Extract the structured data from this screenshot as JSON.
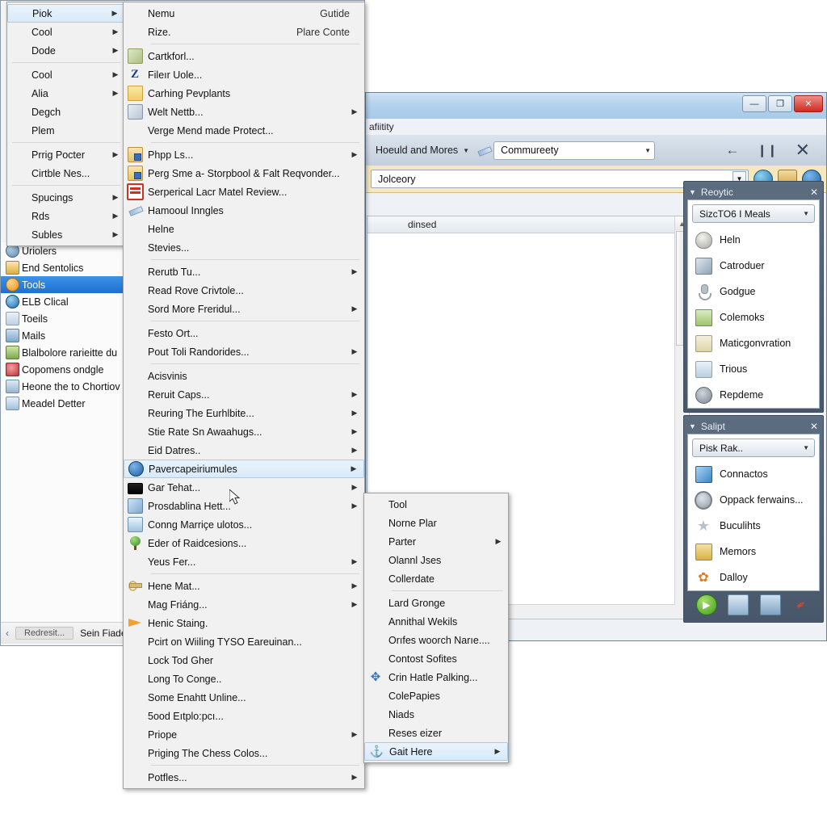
{
  "left_window": {
    "nav_items": [
      {
        "label": "Uriolers",
        "icon": "globe-icon",
        "selected": false
      },
      {
        "label": "End Sentolics",
        "icon": "document-icon",
        "selected": false
      },
      {
        "label": "Tools",
        "icon": "tools-icon",
        "selected": true
      },
      {
        "label": "ELB Clical",
        "icon": "disc-icon",
        "selected": false
      },
      {
        "label": "Toeils",
        "icon": "window-icon",
        "selected": false
      },
      {
        "label": "Mails",
        "icon": "mail-icon",
        "selected": false
      },
      {
        "label": "Blalbolore rarieitte du",
        "icon": "bag-icon",
        "selected": false
      },
      {
        "label": "Copomens ondgle",
        "icon": "heart-icon",
        "selected": false
      },
      {
        "label": "Heone the to Chortiov",
        "icon": "chart-icon",
        "selected": false
      },
      {
        "label": "Meadel Detter",
        "icon": "link-icon",
        "selected": false
      }
    ],
    "status": {
      "back": "‹",
      "pill": "Redresit...",
      "text": "Sein Fiade"
    }
  },
  "top_menu": {
    "items": [
      {
        "label": "Piok",
        "arrow": true,
        "highlight": true
      },
      {
        "label": "Cool",
        "arrow": true
      },
      {
        "label": "Dode",
        "arrow": true
      },
      {
        "sep": true
      },
      {
        "label": "Cool",
        "arrow": true
      },
      {
        "label": "Alia",
        "arrow": true
      },
      {
        "label": "Degch"
      },
      {
        "label": "Plem"
      },
      {
        "sep": true
      },
      {
        "label": "Prrig Pocter",
        "arrow": true
      },
      {
        "label": "Cirtble Nes..."
      },
      {
        "sep": true
      },
      {
        "label": "Spucings",
        "arrow": true
      },
      {
        "label": "Rds",
        "arrow": true
      },
      {
        "label": "Subles",
        "arrow": true
      }
    ]
  },
  "main_menu": {
    "items": [
      {
        "label": "Nemu",
        "accel": "Gutide"
      },
      {
        "label": "Rize.",
        "accel": "Plare Conte"
      },
      {
        "sep": true
      },
      {
        "label": "Cartkforl...",
        "icon": "printer-icon"
      },
      {
        "label": "Fileır Uole...",
        "icon": "z-icon"
      },
      {
        "label": "Carhing Pevplants",
        "icon": "folder-icon"
      },
      {
        "label": "Welt Nettb...",
        "icon": "grid-icon",
        "arrow": true
      },
      {
        "label": "Verge Mend made Protect..."
      },
      {
        "sep": true
      },
      {
        "label": "Phpp Ls...",
        "icon": "doc-blue-icon",
        "arrow": true
      },
      {
        "label": "Perg Sme a- Storpbool & Falt Reqvonder...",
        "icon": "doc-blue-icon"
      },
      {
        "label": "Serperical Lacr Matel Review...",
        "icon": "red-box-icon"
      },
      {
        "label": "Hamooul Inngles",
        "icon": "pen-icon"
      },
      {
        "label": "Helne"
      },
      {
        "label": "Stevies..."
      },
      {
        "sep": true
      },
      {
        "label": "Rerutb Tu...",
        "arrow": true
      },
      {
        "label": "Read Rove Crivtole..."
      },
      {
        "label": "Sord More Freridul...",
        "arrow": true
      },
      {
        "sep": true
      },
      {
        "label": "Festo Ort..."
      },
      {
        "label": "Pout Toli Randorides...",
        "arrow": true
      },
      {
        "sep": true
      },
      {
        "label": "Acisvinis"
      },
      {
        "label": "Reruit Caps...",
        "arrow": true
      },
      {
        "label": "Reuring The Eurhlbite...",
        "arrow": true
      },
      {
        "label": "Stie Rate Sn Awaahugs...",
        "arrow": true
      },
      {
        "label": "Eid Datres..",
        "arrow": true
      },
      {
        "label": "Pavercapeiriumules",
        "icon": "globe-icon",
        "arrow": true,
        "highlight": true
      },
      {
        "label": "Gar Tehat...",
        "icon": "screen-icon",
        "arrow": true
      },
      {
        "label": "Prosdablina Hett...",
        "icon": "blue-card-icon",
        "arrow": true
      },
      {
        "label": "Conng Marriçe ulotos...",
        "icon": "bottle-icon"
      },
      {
        "label": "Eder of Raidcesions...",
        "icon": "tree-icon"
      },
      {
        "label": "Yeus Fer...",
        "arrow": true
      },
      {
        "sep": true
      },
      {
        "label": "Hene Mat...",
        "icon": "key-icon",
        "arrow": true
      },
      {
        "label": "Mag Friáng...",
        "arrow": true
      },
      {
        "label": "Henic Staing.",
        "icon": "bird-icon"
      },
      {
        "label": "Pcirt on Wiiling TYSO Eareuinan..."
      },
      {
        "label": "Lock Tod Gher"
      },
      {
        "label": "Long To Conge.."
      },
      {
        "label": "Some Enahtt Unline..."
      },
      {
        "label": "5ood Eıtplo:pcı..."
      },
      {
        "label": "Priope",
        "arrow": true
      },
      {
        "label": "Priging The Chess Colos..."
      },
      {
        "sep": true
      },
      {
        "label": "Potfles...",
        "arrow": true
      }
    ]
  },
  "sub_menu": {
    "items": [
      {
        "label": "Tool"
      },
      {
        "label": "Norne Plar"
      },
      {
        "label": "Parter",
        "arrow": true
      },
      {
        "label": "Olannl Jses"
      },
      {
        "label": "Collerdate"
      },
      {
        "sep": true
      },
      {
        "label": "Lard Gronge"
      },
      {
        "label": "Annithal Wekils"
      },
      {
        "label": "Orıfes woorch Narıe...."
      },
      {
        "label": "Contost Sofites"
      },
      {
        "label": "Crin Hatle Palking...",
        "icon": "move-icon"
      },
      {
        "label": "ColePapies"
      },
      {
        "label": "Niads"
      },
      {
        "label": "Reses eizer"
      },
      {
        "label": "Gait Here",
        "icon": "anchor-icon",
        "arrow": true,
        "highlight": true
      }
    ]
  },
  "right_window": {
    "menu_label": "afiitity",
    "toolbar": {
      "dropdown_label": "Hoeuld and Mores",
      "combo_value": "Commureety",
      "actions": [
        "back-arrow-icon",
        "pause-icon",
        "close-x-icon"
      ]
    },
    "address_bar": {
      "value": "Jolceory",
      "icons": [
        "globe-icon",
        "picture-icon",
        "circle-blue-icon"
      ]
    },
    "content": {
      "column_header": "dinsed"
    },
    "panels": [
      {
        "title": "Reoytic",
        "combo": "SizcTO6 I Meals",
        "items": [
          {
            "label": "Heln",
            "icon": "bulb-icon"
          },
          {
            "label": "Catroduer",
            "icon": "book-icon"
          },
          {
            "label": "Godgue",
            "icon": "mic-icon"
          },
          {
            "label": "Colemoks",
            "icon": "folder-green-icon"
          },
          {
            "label": "Maticgonvration",
            "icon": "window-icon"
          },
          {
            "label": "Trious",
            "icon": "picture-icon"
          },
          {
            "label": "Repdeme",
            "icon": "gear-icon"
          }
        ]
      },
      {
        "title": "Salipt",
        "combo": "Pisk Rak..",
        "items": [
          {
            "label": "Connactos",
            "icon": "cube-icon"
          },
          {
            "label": "Oppack ferwains...",
            "icon": "ring-icon"
          },
          {
            "label": "Buculihts",
            "icon": "star-icon"
          },
          {
            "label": "Memors",
            "icon": "gold-icon"
          },
          {
            "label": "Dalloy",
            "icon": "fire-icon"
          }
        ],
        "footer_buttons": [
          "go-icon",
          "search-window-icon",
          "copy-icon",
          "eyedropper-icon"
        ]
      }
    ],
    "window_buttons": {
      "minimize": "—",
      "maximize": "❐",
      "close": "✕"
    }
  },
  "colors": {
    "selection_blue": "#1f6fd0",
    "menu_highlight": "#d9eafa",
    "dock_bg": "#48576a",
    "address_bar_bg": "#f6e7bd",
    "close_red": "#cf2a21"
  }
}
